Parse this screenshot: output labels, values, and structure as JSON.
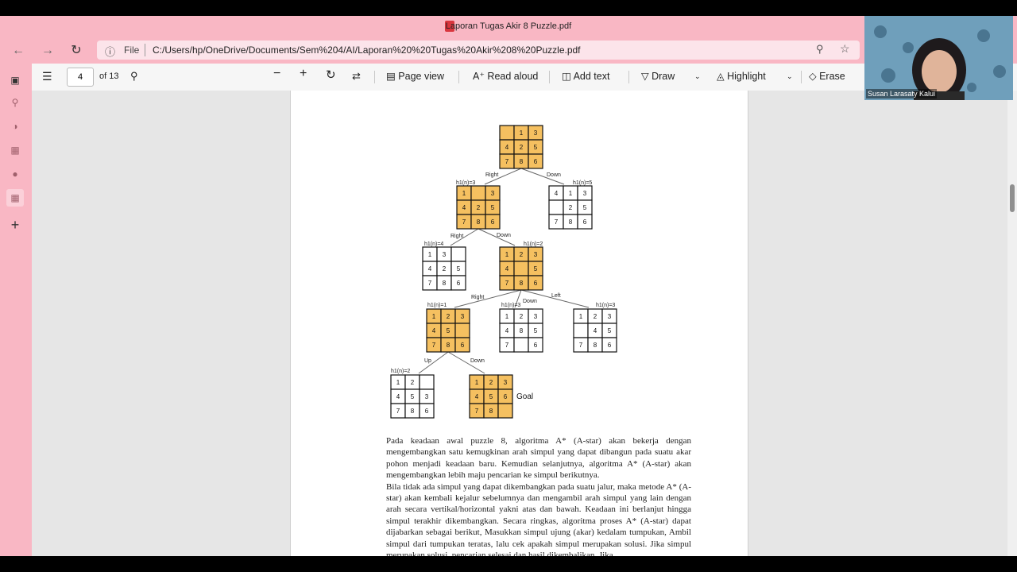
{
  "window": {
    "title": "Laporan Tugas Akir 8 Puzzle.pdf"
  },
  "address_bar": {
    "file_label": "File",
    "url": "C:/Users/hp/OneDrive/Documents/Sem%204/AI/Laporan%20%20Tugas%20Akir%208%20Puzzle.pdf"
  },
  "toolbar": {
    "page_number": "4",
    "page_count": "of 13",
    "page_view": "Page view",
    "read_aloud": "Read aloud",
    "add_text": "Add text",
    "draw": "Draw",
    "highlight": "Highlight",
    "erase": "Erase"
  },
  "webcam": {
    "name": "Susan Larasaty Kalui"
  },
  "diagram": {
    "labels": {
      "right": "Right",
      "down": "Down",
      "left": "Left",
      "up": "Up",
      "goal": "Goal",
      "h_a2": "h1(n)=3",
      "h_b2": "h1(n)=5",
      "h_a3": "h1(n)=4",
      "h_b3": "h1(n)=2",
      "h_a4": "h1(n)=1",
      "h_b4": "h1(n)=3",
      "h_c4": "h1(n)=3",
      "h_a5": "h1(n)=2"
    },
    "grids": {
      "root": [
        "",
        "1",
        "3",
        "4",
        "2",
        "5",
        "7",
        "8",
        "6"
      ],
      "l2a": [
        "1",
        "",
        "3",
        "4",
        "2",
        "5",
        "7",
        "8",
        "6"
      ],
      "l2b": [
        "4",
        "1",
        "3",
        "",
        "2",
        "5",
        "7",
        "8",
        "6"
      ],
      "l3a": [
        "1",
        "3",
        "",
        "4",
        "2",
        "5",
        "7",
        "8",
        "6"
      ],
      "l3b": [
        "1",
        "2",
        "3",
        "4",
        "",
        "5",
        "7",
        "8",
        "6"
      ],
      "l4a": [
        "1",
        "2",
        "3",
        "4",
        "5",
        "",
        "7",
        "8",
        "6"
      ],
      "l4b": [
        "1",
        "2",
        "3",
        "4",
        "8",
        "5",
        "7",
        "",
        "6"
      ],
      "l4c": [
        "1",
        "2",
        "3",
        "",
        "4",
        "5",
        "7",
        "8",
        "6"
      ],
      "l5a": [
        "1",
        "2",
        "",
        "4",
        "5",
        "3",
        "7",
        "8",
        "6"
      ],
      "goal": [
        "1",
        "2",
        "3",
        "4",
        "5",
        "6",
        "7",
        "8",
        ""
      ]
    }
  },
  "document": {
    "paragraph1": "Pada keadaan awal puzzle 8, algoritma A* (A-star) akan bekerja dengan mengembangkan satu kemugkinan arah simpul yang dapat dibangun pada suatu akar pohon menjadi keadaan baru. Kemudian selanjutnya, algoritma A* (A-star) akan mengembangkan lebih maju pencarian ke simpul berikutnya.",
    "paragraph2": "Bila tidak ada simpul yang dapat dikembangkan pada suatu jalur, maka metode A* (A-star) akan kembali kejalur sebelumnya dan mengambil arah simpul yang lain dengan arah secara vertikal/horizontal yakni atas dan bawah. Keadaan ini berlanjut hingga simpul terakhir dikembangkan. Secara ringkas, algoritma proses A* (A-star) dapat dijabarkan sebagai berikut, Masukkan simpul ujung (akar) kedalam tumpukan, Ambil simpul dari tumpukan teratas, lalu cek apakah simpul merupakan solusi. Jika simpul merupakan solusi, pencarian selesai dan hasil dikembalikan. Jika"
  },
  "colors": {
    "pink": "#f9b7c4",
    "tile_yellow": "#f5c060",
    "accent_red": "#d9363e"
  },
  "icons": [
    "back-icon",
    "forward-icon",
    "refresh-icon",
    "info-icon",
    "zoom-icon",
    "favorite-icon",
    "toc-icon",
    "search-icon",
    "zoom-out-icon",
    "zoom-in-icon",
    "rotate-icon",
    "fit-icon",
    "page-view-icon",
    "read-aloud-icon",
    "add-text-icon",
    "draw-icon",
    "highlight-icon",
    "erase-icon"
  ]
}
